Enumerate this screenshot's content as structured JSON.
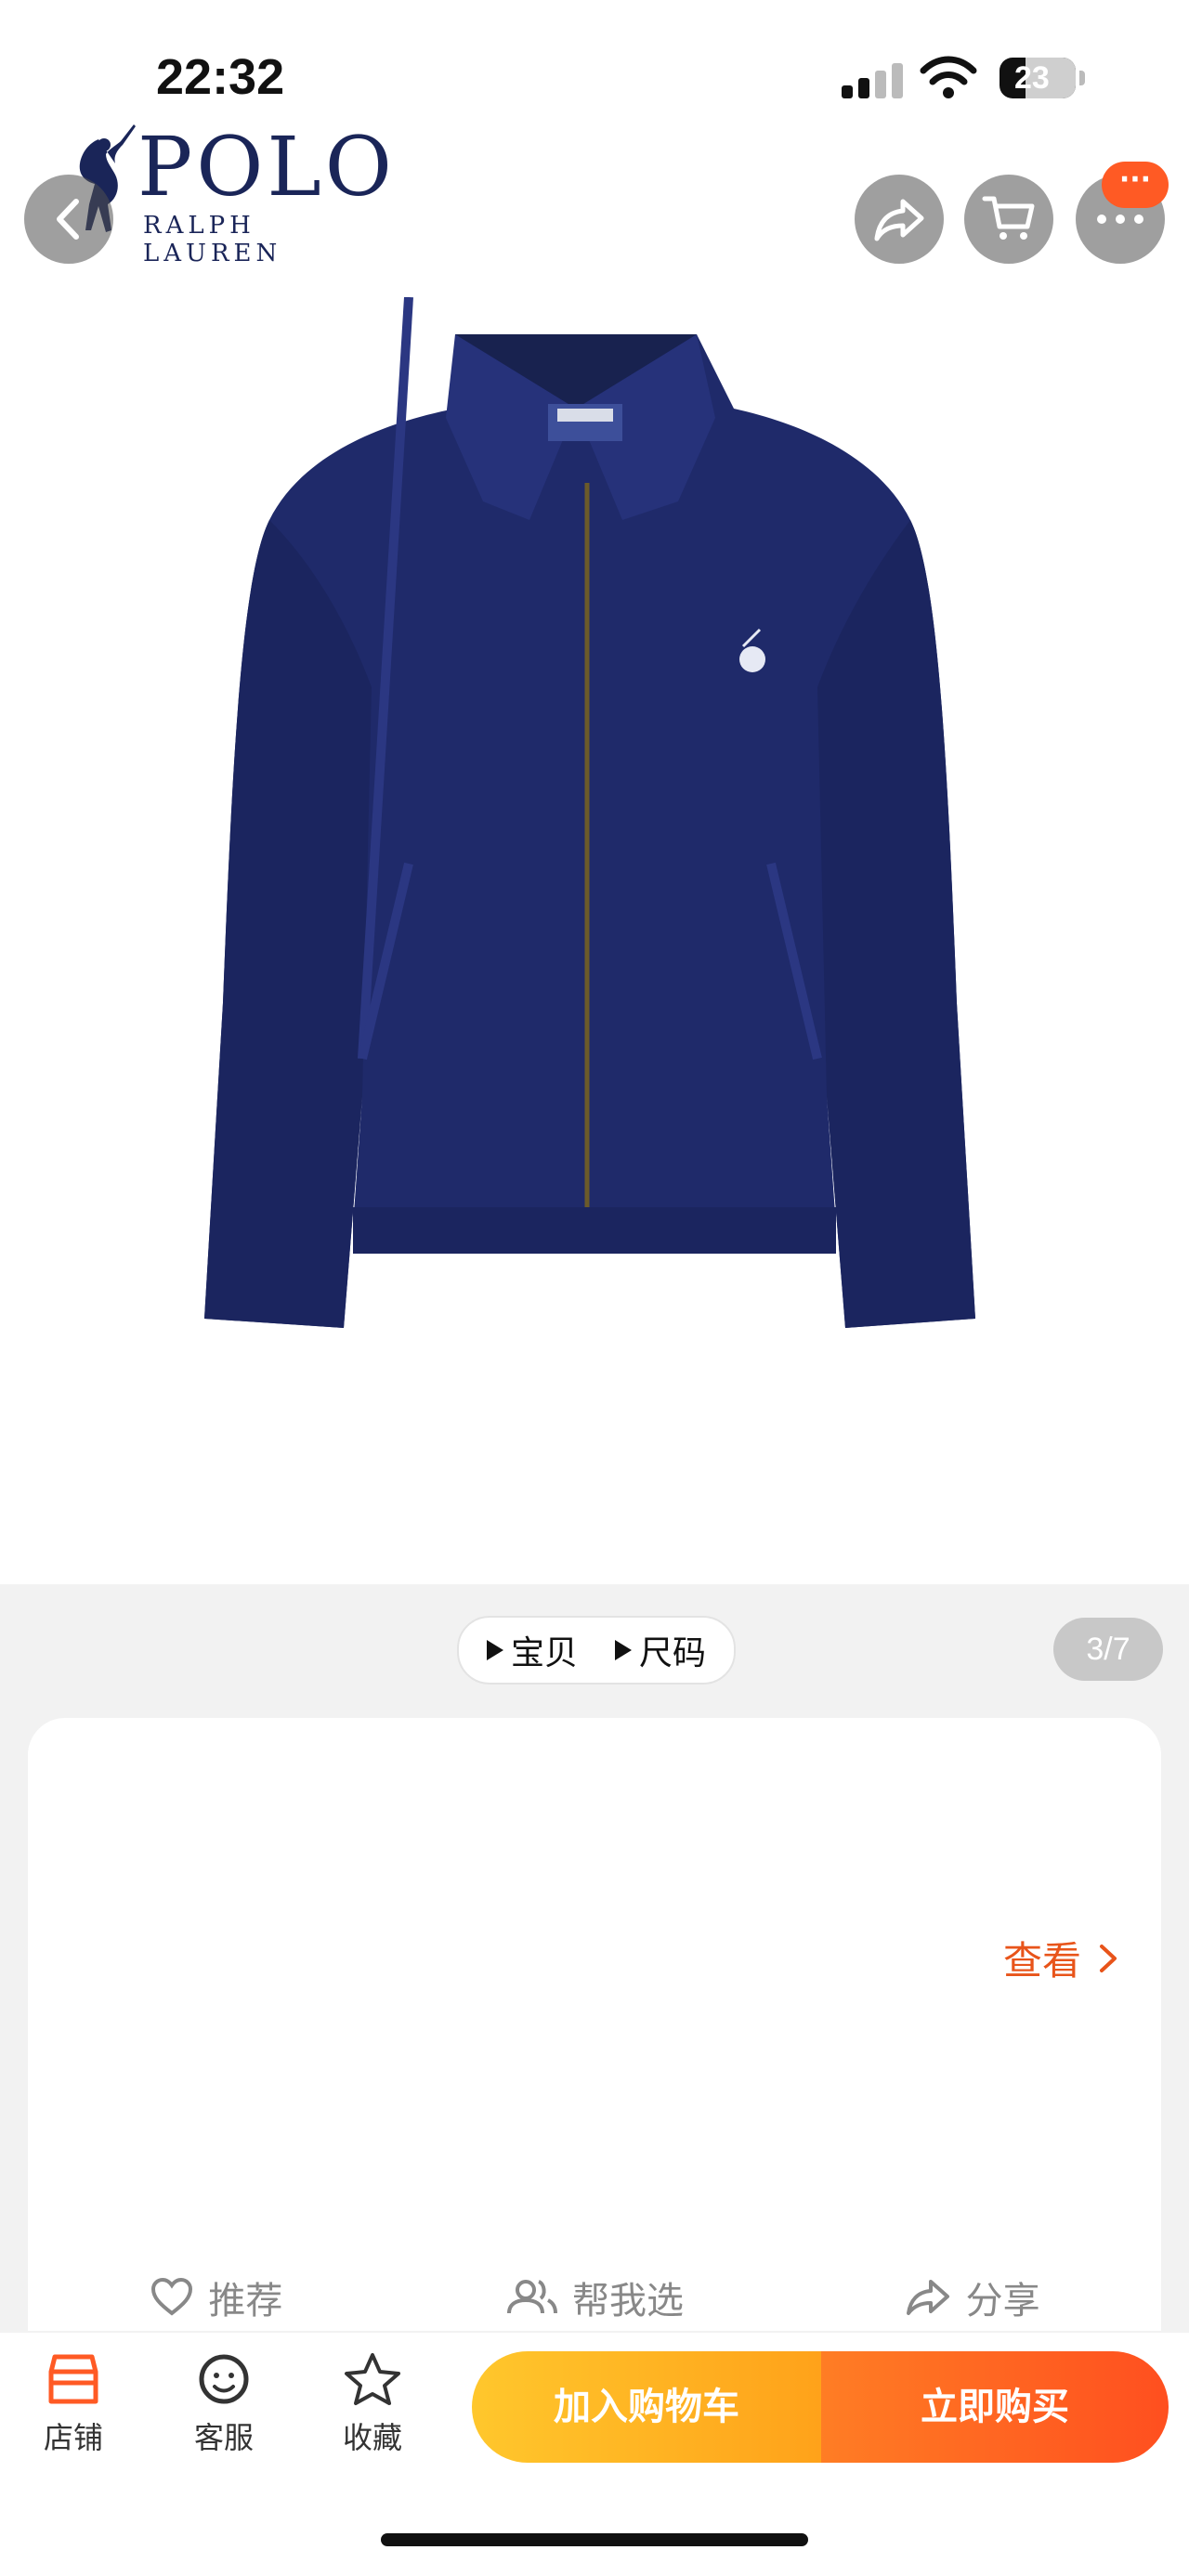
{
  "status_bar": {
    "time": "22:32",
    "battery": "23"
  },
  "brand": {
    "name": "POLO",
    "sub": "RALPH LAUREN"
  },
  "header": {
    "back_icon": "chevron-left-icon",
    "share_icon": "share-arrow-icon",
    "cart_icon": "cart-icon",
    "more_icon": "more-dots-icon",
    "message_badge": "···"
  },
  "gallery": {
    "tabs": [
      {
        "label": "宝贝"
      },
      {
        "label": "尺码"
      }
    ],
    "page_indicator": "3/7"
  },
  "info_card": {
    "view_link": "查看",
    "actions": [
      {
        "label": "推荐",
        "icon": "heart-icon"
      },
      {
        "label": "帮我选",
        "icon": "people-icon"
      },
      {
        "label": "分享",
        "icon": "share-icon"
      }
    ]
  },
  "bottom_bar": {
    "nav": [
      {
        "label": "店铺",
        "icon": "store-icon"
      },
      {
        "label": "客服",
        "icon": "service-icon"
      },
      {
        "label": "收藏",
        "icon": "star-icon"
      }
    ],
    "add_to_cart": "加入购物车",
    "buy_now": "立即购买"
  },
  "colors": {
    "accent": "#ff5a24",
    "cart_gradient": "#ffc72c",
    "buy_gradient": "#ff4f1f",
    "jacket": "#1f2a6a"
  }
}
